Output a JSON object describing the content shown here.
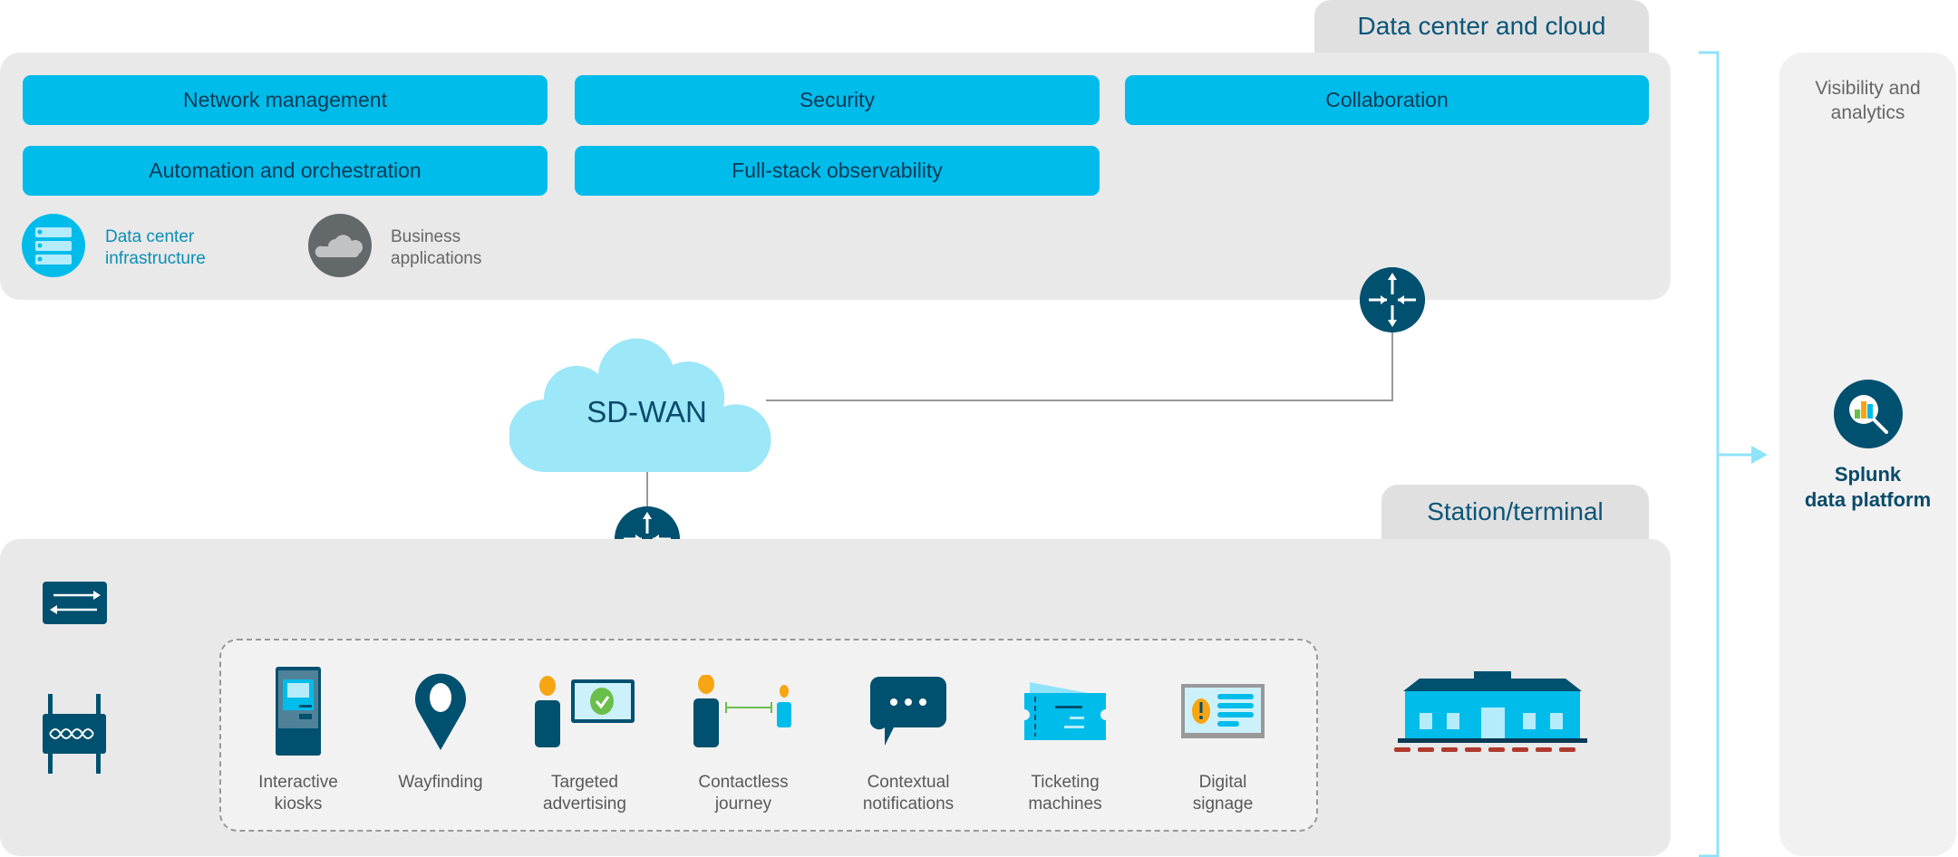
{
  "data_center": {
    "tab_label": "Data center and cloud",
    "buttons": [
      "Network management",
      "Security",
      "Collaboration",
      "Automation and orchestration",
      "Full-stack observability"
    ],
    "infra_label_1": "Data center",
    "infra_label_2": "infrastructure",
    "apps_label_1": "Business",
    "apps_label_2": "applications",
    "icons": [
      "server-icon",
      "cloud-icon",
      "router-icon"
    ]
  },
  "wan": {
    "label": "SD-WAN"
  },
  "station": {
    "tab_label": "Station/terminal",
    "items": [
      {
        "l1": "Interactive",
        "l2": "kiosks",
        "icon": "kiosk-icon"
      },
      {
        "l1": "Wayfinding",
        "l2": "",
        "icon": "map-pin-icon"
      },
      {
        "l1": "Targeted",
        "l2": "advertising",
        "icon": "advertising-icon"
      },
      {
        "l1": "Contactless",
        "l2": "journey",
        "icon": "distance-icon"
      },
      {
        "l1": "Contextual",
        "l2": "notifications",
        "icon": "chat-icon"
      },
      {
        "l1": "Ticketing",
        "l2": "machines",
        "icon": "ticket-icon"
      },
      {
        "l1": "Digital",
        "l2": "signage",
        "icon": "signage-icon"
      }
    ]
  },
  "analytics": {
    "title_1": "Visibility and",
    "title_2": "analytics",
    "platform_1": "Splunk",
    "platform_2": "data platform"
  },
  "colors": {
    "accent": "#00bceb",
    "dark": "#00506f",
    "panel": "#e9e9e9",
    "bracket": "#8fe3fb"
  }
}
